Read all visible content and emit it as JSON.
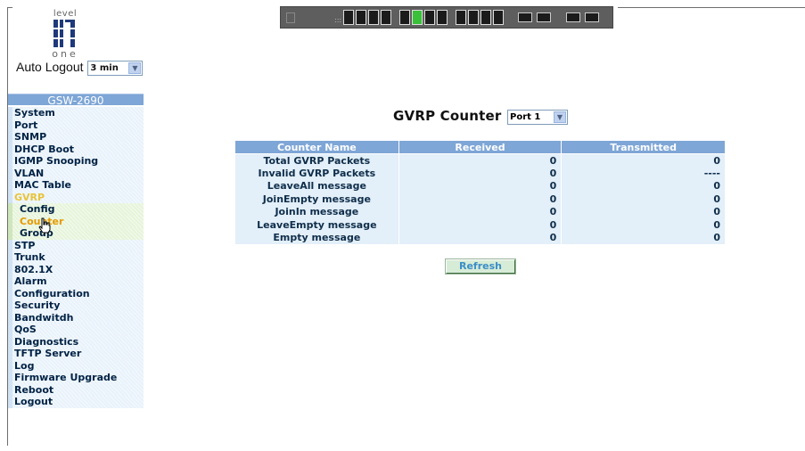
{
  "logo": {
    "word_top": "level",
    "word_bottom": "one"
  },
  "auto_logout": {
    "label": "Auto Logout",
    "value": "3 min"
  },
  "sidebar": {
    "device_name": "GSW-2690",
    "items": [
      {
        "label": "System"
      },
      {
        "label": "Port"
      },
      {
        "label": "SNMP"
      },
      {
        "label": "DHCP Boot"
      },
      {
        "label": "IGMP Snooping"
      },
      {
        "label": "VLAN"
      },
      {
        "label": "MAC Table"
      },
      {
        "label": "GVRP"
      },
      {
        "label": "Config"
      },
      {
        "label": "Counter"
      },
      {
        "label": "Group"
      },
      {
        "label": "STP"
      },
      {
        "label": "Trunk"
      },
      {
        "label": "802.1X"
      },
      {
        "label": "Alarm"
      },
      {
        "label": "Configuration"
      },
      {
        "label": "Security"
      },
      {
        "label": "Bandwitdh"
      },
      {
        "label": "QoS"
      },
      {
        "label": "Diagnostics"
      },
      {
        "label": "TFTP Server"
      },
      {
        "label": "Log"
      },
      {
        "label": "Firmware Upgrade"
      },
      {
        "label": "Reboot"
      },
      {
        "label": "Logout"
      }
    ]
  },
  "main": {
    "title": "GVRP Counter",
    "port_select": "Port 1",
    "table": {
      "headers": [
        "Counter Name",
        "Received",
        "Transmitted"
      ],
      "rows": [
        {
          "name": "Total GVRP Packets",
          "received": "0",
          "transmitted": "0"
        },
        {
          "name": "Invalid GVRP Packets",
          "received": "0",
          "transmitted": "----"
        },
        {
          "name": "LeaveAll message",
          "received": "0",
          "transmitted": "0"
        },
        {
          "name": "JoinEmpty message",
          "received": "0",
          "transmitted": "0"
        },
        {
          "name": "JoinIn message",
          "received": "0",
          "transmitted": "0"
        },
        {
          "name": "LeaveEmpty message",
          "received": "0",
          "transmitted": "0"
        },
        {
          "name": "Empty message",
          "received": "0",
          "transmitted": "0"
        }
      ]
    },
    "refresh_label": "Refresh"
  },
  "colors": {
    "header_blue": "#7ea6d6",
    "row_blue": "#e3eff9",
    "sub_green": "#e6f4da",
    "active_yellow": "#e8c43a",
    "current_orange": "#e59a00"
  }
}
